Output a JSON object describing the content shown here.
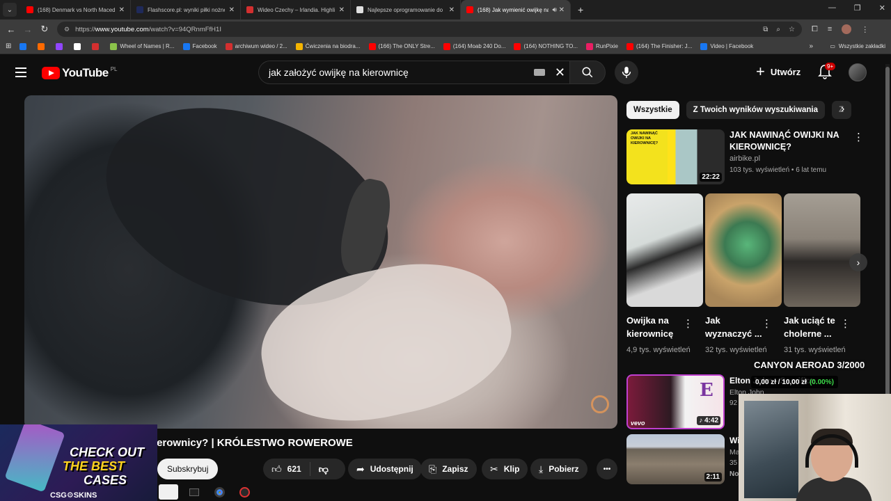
{
  "browser": {
    "tabs": [
      {
        "title": "(168) Denmark vs North Macedonia",
        "color": "#ff0000"
      },
      {
        "title": "Flashscore.pl: wyniki piłki nożnej",
        "color": "#1f2a5a"
      },
      {
        "title": "Wideo Czechy – Irlandia. Highlights",
        "color": "#d32f2f"
      },
      {
        "title": "Najlepsze oprogramowanie do",
        "color": "#e0e0e0"
      },
      {
        "title": "(168) Jak wymienić owijkę na",
        "color": "#ff0000",
        "active": true
      }
    ],
    "url_prefix": "https://",
    "url_host": "www.youtube.com",
    "url_path": "/watch?v=94QRnmFfH1I",
    "bookmarks": [
      {
        "label": "",
        "color": "#1877f2"
      },
      {
        "label": "",
        "color": "#ff6a00"
      },
      {
        "label": "",
        "color": "#9146ff"
      },
      {
        "label": "",
        "color": "#ffffff"
      },
      {
        "label": "",
        "color": "#d32f2f"
      },
      {
        "label": "Wheel of Names | R...",
        "color": "#8bc34a"
      },
      {
        "label": "Facebook",
        "color": "#1877f2"
      },
      {
        "label": "archiwum wideo / 2...",
        "color": "#d32f2f"
      },
      {
        "label": "Ćwiczenia na biodra...",
        "color": "#f4b400"
      },
      {
        "label": "(166) The ONLY Stre...",
        "color": "#ff0000"
      },
      {
        "label": "(164) Moab 240 Do...",
        "color": "#ff0000"
      },
      {
        "label": "(164) NOTHING TO...",
        "color": "#ff0000"
      },
      {
        "label": "RunPixie",
        "color": "#e91e63"
      },
      {
        "label": "(164) The Finisher: J...",
        "color": "#ff0000"
      },
      {
        "label": "Video | Facebook",
        "color": "#1877f2"
      }
    ],
    "bookmarks_more": "»",
    "all_bookmarks": "Wszystkie zakładki"
  },
  "header": {
    "logo_text": "YouTube",
    "country": "PL",
    "search_query": "jak założyć owijkę na kierownicę",
    "create_label": "Utwórz",
    "notifications": "9+"
  },
  "video": {
    "title": "Jak wymienić owijkę na kierownicy? | KRÓLESTWO ROWEROWE",
    "subscribe": "Subskrybuj",
    "likes": "621",
    "share": "Udostępnij",
    "save": "Zapisz",
    "clip": "Klip",
    "download": "Pobierz",
    "more": "•••"
  },
  "sidebar": {
    "chips": [
      "Wszystkie",
      "Z Twoich wyników wyszukiwania",
      "Z"
    ],
    "rec1": {
      "thumb_text": "JAK NAWINĄĆ OWIJKI NA KIEROWNICĘ?",
      "duration": "22:22",
      "title": "JAK NAWINĄĆ OWIJKI NA KIEROWNICĘ?",
      "channel": "airbike.pl",
      "meta": "103 tys. wyświetleń • 6 lat temu"
    },
    "shorts": [
      {
        "title": "Owijka na kierownicę",
        "meta": "4,9 tys. wyświetleń",
        "color1": "#e8eaea",
        "color2": "#2b2b2b"
      },
      {
        "title": "Jak wyznaczyć ...",
        "meta": "32 tys. wyświetleń",
        "color1": "#c9a36a",
        "color2": "#3c7a52"
      },
      {
        "title": "Jak uciąć te cholerne ...",
        "meta": "31 tys. wyświetleń",
        "color1": "#8a8278",
        "color2": "#2d2a28"
      }
    ],
    "rec2": {
      "title": "Elton John - Sacrifice",
      "channel": "Elton John",
      "meta": "92",
      "duration": "4:42",
      "badge": "vevo",
      "letter": "E"
    },
    "rec3": {
      "title": "Wi",
      "channel": "Ma",
      "meta": "35",
      "extra": "No",
      "duration": "2:11"
    }
  },
  "overlays": {
    "stream_title": "CANYON AEROAD 3/2000",
    "price": "0,00 zł / 10,00 zł",
    "pct": "(0.00%)",
    "promo_line1": "CHECK OUT",
    "promo_line2": "THE BEST",
    "promo_line3": "CASES",
    "promo_brand": "CSG⚙SKINS"
  }
}
